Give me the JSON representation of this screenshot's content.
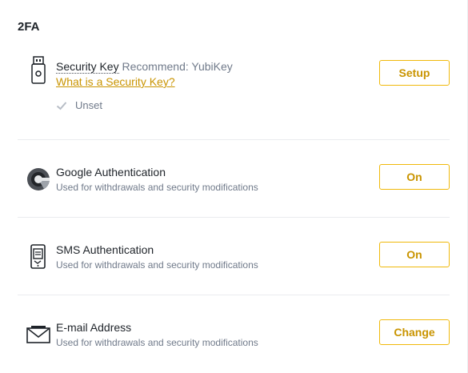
{
  "section": {
    "title": "2FA"
  },
  "security_key": {
    "title": "Security Key",
    "recommend": "Recommend: YubiKey",
    "link": "What is a Security Key?",
    "status": "Unset",
    "button": "Setup",
    "icon": "usb-key-icon"
  },
  "google": {
    "title": "Google Authentication",
    "desc": "Used for withdrawals and security modifications",
    "button": "On",
    "icon": "google-authenticator-icon"
  },
  "sms": {
    "title": "SMS Authentication",
    "desc": "Used for withdrawals and security modifications",
    "button": "On",
    "icon": "sms-phone-icon"
  },
  "email": {
    "title": "E-mail Address",
    "desc": "Used for withdrawals and security modifications",
    "button": "Change",
    "icon": "envelope-icon"
  },
  "colors": {
    "accent": "#f0b90b",
    "link": "#c99400",
    "muted": "#707a8a"
  }
}
